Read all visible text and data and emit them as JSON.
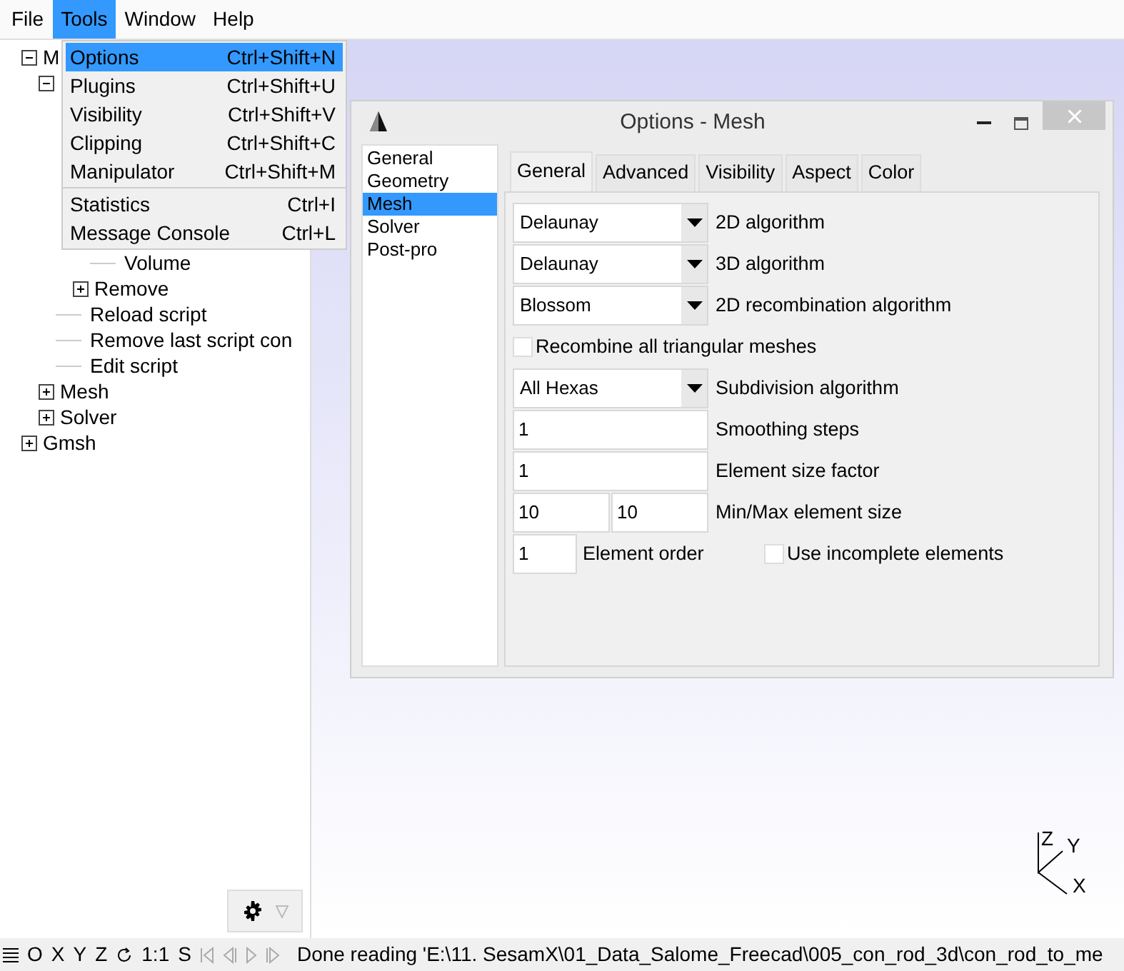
{
  "menu_bar": [
    {
      "label": "File",
      "selected": false
    },
    {
      "label": "Tools",
      "selected": true
    },
    {
      "label": "Window",
      "selected": false
    },
    {
      "label": "Help",
      "selected": false
    }
  ],
  "tools_menu": [
    {
      "label": "Options",
      "shortcut": "Ctrl+Shift+N",
      "selected": true,
      "separator_after": false
    },
    {
      "label": "Plugins",
      "shortcut": "Ctrl+Shift+U",
      "selected": false,
      "separator_after": false
    },
    {
      "label": "Visibility",
      "shortcut": "Ctrl+Shift+V",
      "selected": false,
      "separator_after": false
    },
    {
      "label": "Clipping",
      "shortcut": "Ctrl+Shift+C",
      "selected": false,
      "separator_after": false
    },
    {
      "label": "Manipulator",
      "shortcut": "Ctrl+Shift+M",
      "selected": false,
      "separator_after": true
    },
    {
      "label": "Statistics",
      "shortcut": "Ctrl+I",
      "selected": false,
      "separator_after": false
    },
    {
      "label": "Message Console",
      "shortcut": "Ctrl+L",
      "selected": false,
      "separator_after": false
    }
  ],
  "tree": [
    {
      "label": "M",
      "expanded": true,
      "children": [
        {
          "expanded": true,
          "children": [
            {
              "children": [
                {
                  "children": [
                    {
                      "label": "Volume"
                    }
                  ]
                },
                {
                  "label": "Remove",
                  "expanded": false
                }
              ]
            },
            {
              "label": "Reload script"
            },
            {
              "label": "Remove last script con"
            },
            {
              "label": "Edit script"
            }
          ]
        },
        {
          "label": "Mesh",
          "expanded": false
        },
        {
          "label": "Solver",
          "expanded": false
        }
      ]
    },
    {
      "label": "Gmsh",
      "expanded": false
    }
  ],
  "options_window": {
    "title": "Options - Mesh",
    "categories": [
      {
        "label": "General",
        "selected": false
      },
      {
        "label": "Geometry",
        "selected": false
      },
      {
        "label": "Mesh",
        "selected": true
      },
      {
        "label": "Solver",
        "selected": false
      },
      {
        "label": "Post-pro",
        "selected": false
      }
    ],
    "tabs": [
      {
        "label": "General",
        "selected": true
      },
      {
        "label": "Advanced",
        "selected": false
      },
      {
        "label": "Visibility",
        "selected": false
      },
      {
        "label": "Aspect",
        "selected": false
      },
      {
        "label": "Color",
        "selected": false
      }
    ],
    "fields": [
      {
        "kind": "dropdown",
        "value": "Delaunay",
        "label": "2D algorithm"
      },
      {
        "kind": "dropdown",
        "value": "Delaunay",
        "label": "3D algorithm"
      },
      {
        "kind": "dropdown",
        "value": "Blossom",
        "label": "2D recombination algorithm"
      },
      {
        "kind": "checkbox",
        "checked": false,
        "text": "Recombine all triangular meshes"
      },
      {
        "kind": "dropdown",
        "value": "All Hexas",
        "label": "Subdivision algorithm"
      },
      {
        "kind": "input",
        "value": "1",
        "label": "Smoothing steps"
      },
      {
        "kind": "input",
        "value": "1",
        "label": "Element size factor"
      },
      {
        "kind": "pair",
        "values": [
          "10",
          "10"
        ],
        "label": "Min/Max element size"
      },
      {
        "kind": "order",
        "value": "1",
        "label": "Element order",
        "checkbox": {
          "checked": false,
          "label": "Use incomplete elements"
        }
      }
    ]
  },
  "axes": {
    "labels": [
      "Z",
      "Y",
      "X"
    ]
  },
  "status_bar": {
    "views": [
      "O",
      "X",
      "Y",
      "Z"
    ],
    "scale": "1:1",
    "snap": "S",
    "message": "Done reading 'E:\\11. SesamX\\01_Data_Salome_Freecad\\005_con_rod_3d\\con_rod_to_me"
  }
}
